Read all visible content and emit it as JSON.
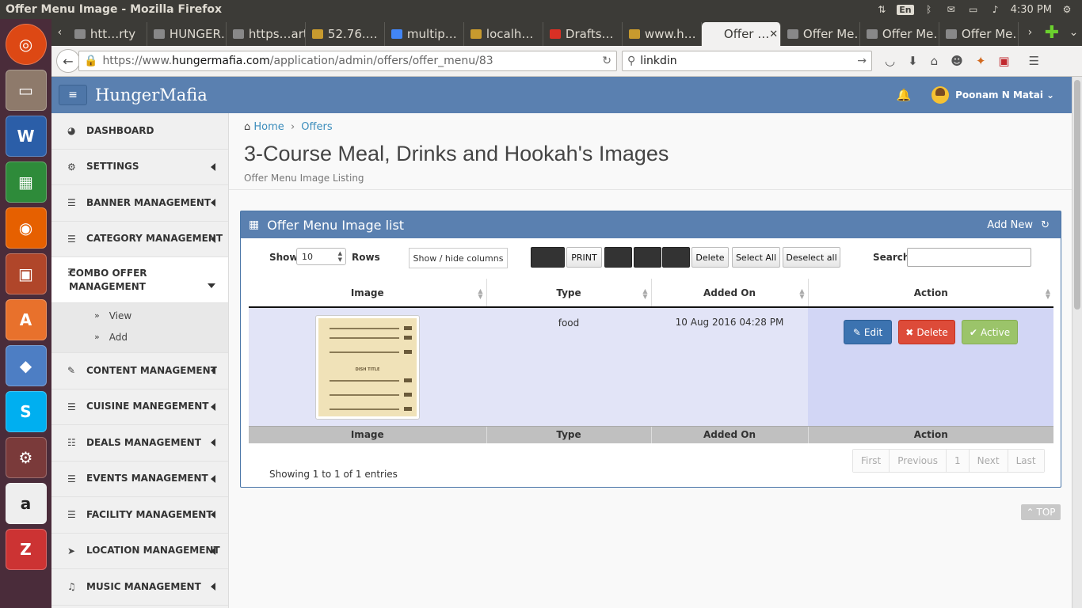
{
  "window": {
    "title": "Offer Menu Image - Mozilla Firefox"
  },
  "tray": {
    "lang": "En",
    "time": "4:30 PM"
  },
  "tabs": [
    {
      "label": "htt…rty",
      "fav_color": "#888"
    },
    {
      "label": "HUNGER…",
      "fav_color": "#888"
    },
    {
      "label": "https…arty",
      "fav_color": "#888"
    },
    {
      "label": "52.76.…",
      "fav_color": "#c79a2e"
    },
    {
      "label": "multip…",
      "fav_color": "#4285f4"
    },
    {
      "label": "localh…",
      "fav_color": "#c79a2e"
    },
    {
      "label": "Drafts…",
      "fav_color": "#d93025"
    },
    {
      "label": "www.h…",
      "fav_color": "#c79a2e"
    },
    {
      "label": "Offer …",
      "fav_color": "#f2f1f0",
      "active": true
    },
    {
      "label": "Offer Me…",
      "fav_color": "#888"
    },
    {
      "label": "Offer Me…",
      "fav_color": "#888"
    },
    {
      "label": "Offer Me…",
      "fav_color": "#888"
    }
  ],
  "url": {
    "prefix": "https://www.",
    "host": "hungermafia.com",
    "path": "/application/admin/offers/offer_menu/83"
  },
  "search": {
    "value": "linkdin"
  },
  "app": {
    "brand": "HungerMafia",
    "user": "Poonam N Matai"
  },
  "sidebar": {
    "items": [
      {
        "label": "DASHBOARD",
        "icon": "dashboard-icon",
        "glyph": "◕"
      },
      {
        "label": "SETTINGS",
        "icon": "gears-icon",
        "glyph": "⚙"
      },
      {
        "label": "BANNER MANAGEMENT",
        "icon": "list-icon",
        "glyph": "☰"
      },
      {
        "label": "CATEGORY MANAGEMENT",
        "icon": "list-icon",
        "glyph": "☰"
      },
      {
        "label": "COMBO OFFER MANAGEMENT",
        "icon": "list-icon",
        "glyph": "☰"
      },
      {
        "label": "CONTENT MANAGEMENT",
        "icon": "pencil-icon",
        "glyph": "✎"
      },
      {
        "label": "CUISINE MANEGEMENT",
        "icon": "list-icon",
        "glyph": "☰"
      },
      {
        "label": "DEALS MANAGEMENT",
        "icon": "list-alt-icon",
        "glyph": "☷"
      },
      {
        "label": "EVENTS MANAGEMENT",
        "icon": "list-icon",
        "glyph": "☰"
      },
      {
        "label": "FACILITY MANAGEMENT",
        "icon": "list-icon",
        "glyph": "☰"
      },
      {
        "label": "LOCATION MANAGEMENT",
        "icon": "location-arrow-icon",
        "glyph": "➤"
      },
      {
        "label": "MUSIC MANAGEMENT",
        "icon": "music-icon",
        "glyph": "♫"
      }
    ],
    "sub": [
      {
        "label": "View"
      },
      {
        "label": "Add"
      }
    ]
  },
  "breadcrumb": {
    "home": "Home",
    "current": "Offers"
  },
  "page": {
    "title": "3-Course Meal, Drinks and Hookah's Images",
    "subtitle": "Offer Menu Image Listing"
  },
  "panel": {
    "title": "Offer Menu Image list",
    "add_new": "Add New",
    "show": "Show",
    "rows_value": "10",
    "rows": "Rows",
    "show_hide": "Show / hide columns",
    "print": "PRINT",
    "delete": "Delete",
    "select_all": "Select All",
    "deselect_all": "Deselect all",
    "search": "Search:"
  },
  "table": {
    "columns": [
      "Image",
      "Type",
      "Added On",
      "Action"
    ],
    "rows": [
      {
        "type": "food",
        "added_on": "10 Aug 2016 04:28 PM",
        "menu_title": "DISH TITLE"
      }
    ],
    "actions": {
      "edit": "Edit",
      "delete": "Delete",
      "active": "Active"
    },
    "info": "Showing 1 to 1 of 1 entries"
  },
  "pager": [
    "First",
    "Previous",
    "1",
    "Next",
    "Last"
  ],
  "top_btn": "TOP",
  "colors": {
    "header": "#5a80b0",
    "launcher": "#4a2c3a",
    "edit": "#3c73b0",
    "delete": "#dd4b39",
    "active": "#9bc46a"
  }
}
